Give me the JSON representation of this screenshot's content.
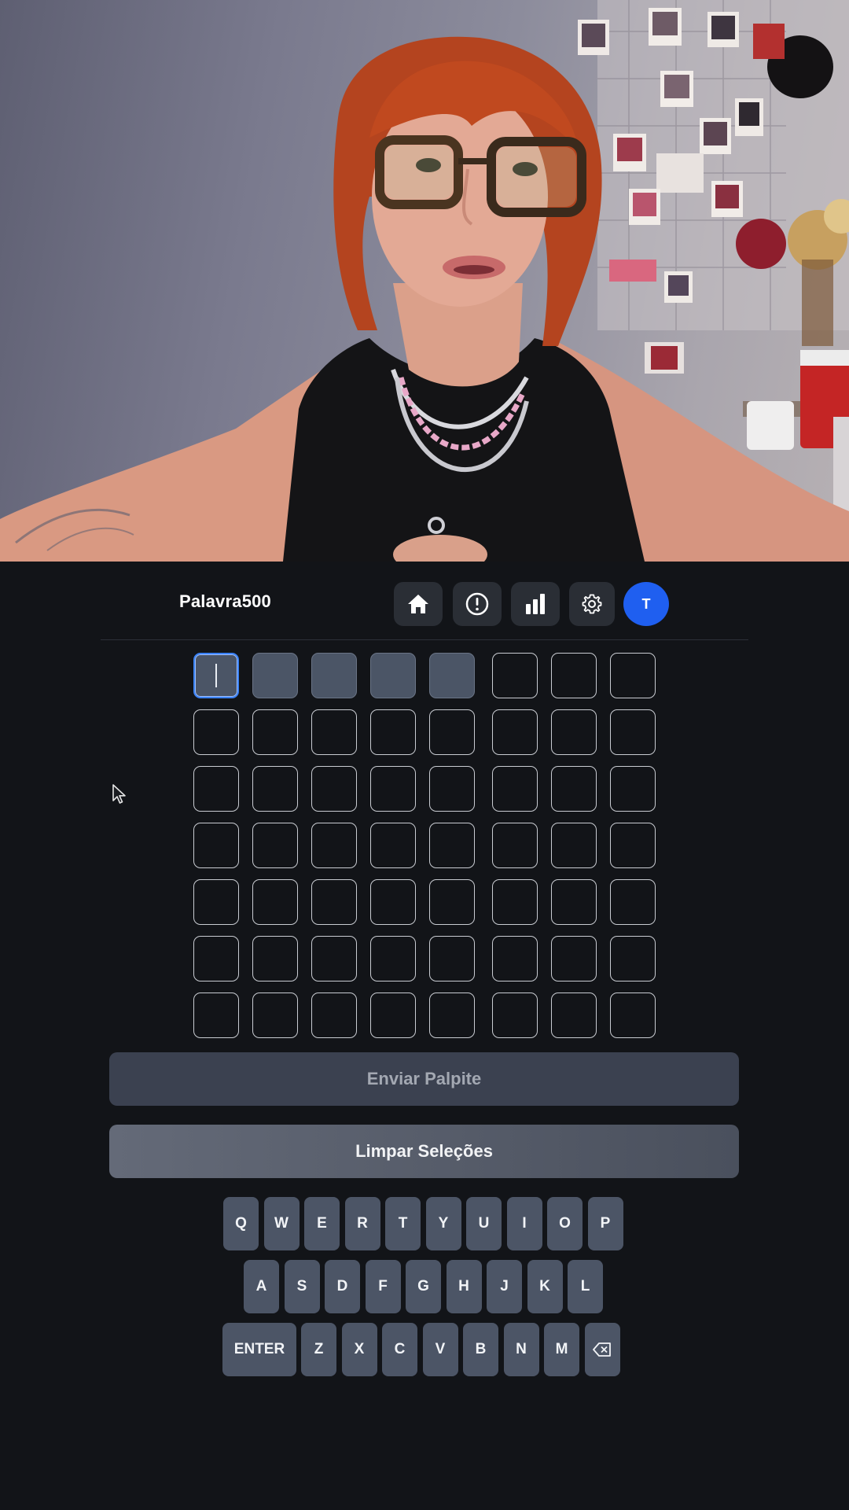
{
  "header": {
    "brand": "Palavra500",
    "buttons": [
      {
        "name": "home",
        "icon": "home-icon"
      },
      {
        "name": "info",
        "icon": "info-icon"
      },
      {
        "name": "stats",
        "icon": "bar-chart-icon"
      },
      {
        "name": "settings",
        "icon": "gear-icon"
      }
    ],
    "avatar_initial": "T"
  },
  "grid": {
    "rows": 7,
    "columns": 8,
    "active_cell": [
      0,
      0
    ],
    "highlighted_cells_row0": [
      0,
      1,
      2,
      3,
      4
    ]
  },
  "actions": {
    "send_label": "Enviar Palpite",
    "clear_label": "Limpar Seleções"
  },
  "keyboard": {
    "row1": [
      "Q",
      "W",
      "E",
      "R",
      "T",
      "Y",
      "U",
      "I",
      "O",
      "P"
    ],
    "row2": [
      "A",
      "S",
      "D",
      "F",
      "G",
      "H",
      "J",
      "K",
      "L"
    ],
    "row3": [
      "ENTER",
      "Z",
      "X",
      "C",
      "V",
      "B",
      "N",
      "M",
      "backspace"
    ]
  },
  "colors": {
    "background": "#121418",
    "accent": "#1f5ff0",
    "key": "#4c5566",
    "highlighted_cell": "#4b5566"
  }
}
